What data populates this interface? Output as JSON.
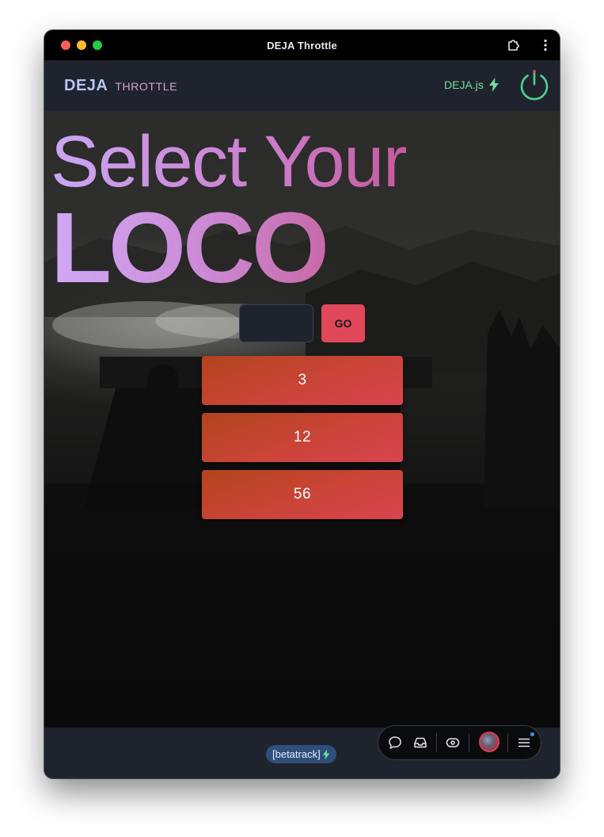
{
  "window": {
    "title": "DEJA Throttle"
  },
  "appbar": {
    "brand_primary": "DEJA",
    "brand_secondary": "THROTTLE",
    "status_label": "DEJA.js",
    "status_color": "#6ee29a",
    "power_color": "#4fd18b"
  },
  "headline": {
    "line1": "Select Your",
    "line2": "LOCO"
  },
  "search": {
    "value": "",
    "go_label": "GO"
  },
  "locos": [
    {
      "label": "3"
    },
    {
      "label": "12"
    },
    {
      "label": "56"
    }
  ],
  "footer": {
    "track_label": "[betatrack]",
    "dock_icons": [
      "chat-bubble-icon",
      "inbox-icon",
      "eye-icon",
      "avatar",
      "hamburger-menu-icon"
    ]
  }
}
